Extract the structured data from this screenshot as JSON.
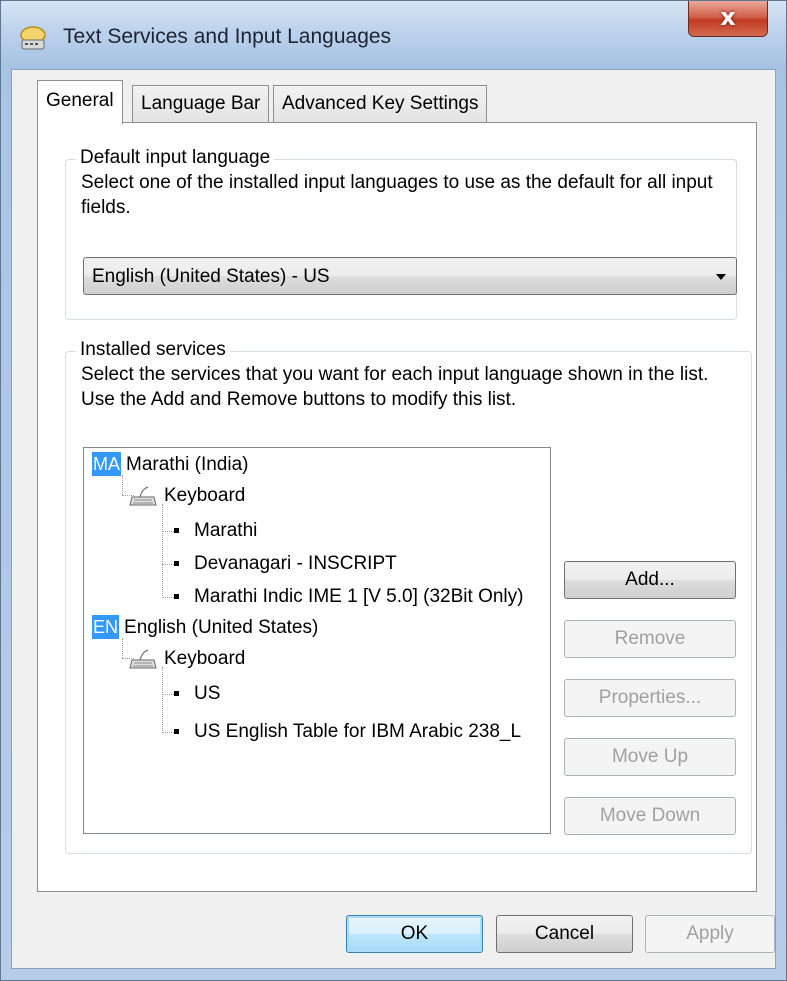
{
  "window": {
    "title": "Text Services and Input Languages",
    "close_glyph": "x"
  },
  "tabs": [
    {
      "label": "General",
      "active": true
    },
    {
      "label": "Language Bar",
      "active": false
    },
    {
      "label": "Advanced Key Settings",
      "active": false
    }
  ],
  "default_input": {
    "legend": "Default input language",
    "description_line1": "Select one of the installed input languages to use as the default for all input",
    "description_line2": "fields.",
    "selected": "English (United States) - US"
  },
  "installed_services": {
    "legend": "Installed services",
    "description_line1": "Select the services that you want for each input language shown in the list.",
    "description_line2": "Use the Add and Remove buttons to modify this list.",
    "tree": {
      "lang1": {
        "badge": "MA",
        "name": "Marathi (India)",
        "group": "Keyboard",
        "items": [
          "Marathi",
          "Devanagari - INSCRIPT",
          "Marathi Indic IME 1 [V 5.0] (32Bit Only)"
        ]
      },
      "lang2": {
        "badge": "EN",
        "name": "English (United States)",
        "group": "Keyboard",
        "items": [
          "US",
          "US English Table for IBM Arabic 238_L"
        ]
      }
    },
    "buttons": {
      "add": "Add...",
      "remove": "Remove",
      "properties": "Properties...",
      "move_up": "Move Up",
      "move_down": "Move Down"
    }
  },
  "footer": {
    "ok": "OK",
    "cancel": "Cancel",
    "apply": "Apply"
  },
  "colors": {
    "selection": "#3399ff",
    "disabled_text": "#a0a0a0",
    "close_red": "#c23b22"
  }
}
